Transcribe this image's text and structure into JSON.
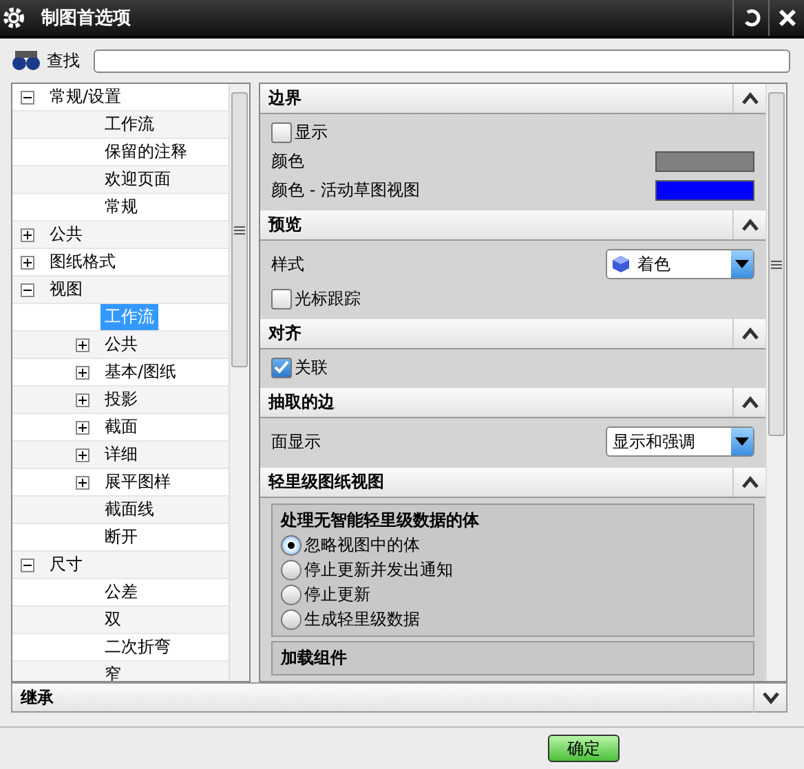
{
  "window": {
    "title": "制图首选项"
  },
  "search": {
    "label": "查找"
  },
  "tree": [
    {
      "label": "常规/设置",
      "expanded": true,
      "selected": false,
      "children": [
        {
          "label": "工作流",
          "selected": false
        },
        {
          "label": "保留的注释",
          "selected": false
        },
        {
          "label": "欢迎页面",
          "selected": false
        },
        {
          "label": "常规",
          "selected": false
        }
      ]
    },
    {
      "label": "公共",
      "expanded": false,
      "selected": false
    },
    {
      "label": "图纸格式",
      "expanded": false,
      "selected": false
    },
    {
      "label": "视图",
      "expanded": true,
      "selected": false,
      "children": [
        {
          "label": "工作流",
          "selected": true
        },
        {
          "label": "公共",
          "expanded": false,
          "selected": false
        },
        {
          "label": "基本/图纸",
          "expanded": false,
          "selected": false
        },
        {
          "label": "投影",
          "expanded": false,
          "selected": false
        },
        {
          "label": "截面",
          "expanded": false,
          "selected": false
        },
        {
          "label": "详细",
          "expanded": false,
          "selected": false
        },
        {
          "label": "展平图样",
          "expanded": false,
          "selected": false
        },
        {
          "label": "截面线",
          "selected": false
        },
        {
          "label": "断开",
          "selected": false
        }
      ]
    },
    {
      "label": "尺寸",
      "expanded": true,
      "selected": false,
      "children": [
        {
          "label": "公差",
          "selected": false
        },
        {
          "label": "双",
          "selected": false
        },
        {
          "label": "二次折弯",
          "selected": false
        },
        {
          "label": "窄",
          "selected": false
        }
      ]
    }
  ],
  "sections": [
    {
      "title": "边界",
      "expanded": true,
      "items": [
        {
          "kind": "checkbox",
          "label": "显示",
          "checked": false
        },
        {
          "kind": "color",
          "label": "颜色",
          "color": "#808080"
        },
        {
          "kind": "color",
          "label": "颜色 - 活动草图视图",
          "color": "#0000ff"
        }
      ]
    },
    {
      "title": "预览",
      "expanded": true,
      "items": [
        {
          "kind": "dropdown",
          "label": "样式",
          "value": "着色",
          "icon": true
        },
        {
          "kind": "checkbox",
          "label": "光标跟踪",
          "checked": false
        }
      ]
    },
    {
      "title": "对齐",
      "expanded": true,
      "items": [
        {
          "kind": "checkbox",
          "label": "关联",
          "checked": true
        }
      ]
    },
    {
      "title": "抽取的边",
      "expanded": true,
      "items": [
        {
          "kind": "dropdown",
          "label": "面显示",
          "value": "显示和强调"
        }
      ]
    },
    {
      "title": "轻里级图纸视图",
      "expanded": true,
      "items": [
        {
          "kind": "radiogroup",
          "label": "处理无智能轻里级数据的体",
          "options": [
            {
              "label": "忽略视图中的体",
              "selected": true
            },
            {
              "label": "停止更新并发出通知",
              "selected": false
            },
            {
              "label": "停止更新",
              "selected": false
            },
            {
              "label": "生成轻里级数据",
              "selected": false
            }
          ]
        },
        {
          "kind": "group",
          "label": "加载组件"
        }
      ]
    }
  ],
  "inherit": {
    "label": "继承",
    "expanded": false
  },
  "buttons": [
    {
      "label": "确定"
    }
  ]
}
